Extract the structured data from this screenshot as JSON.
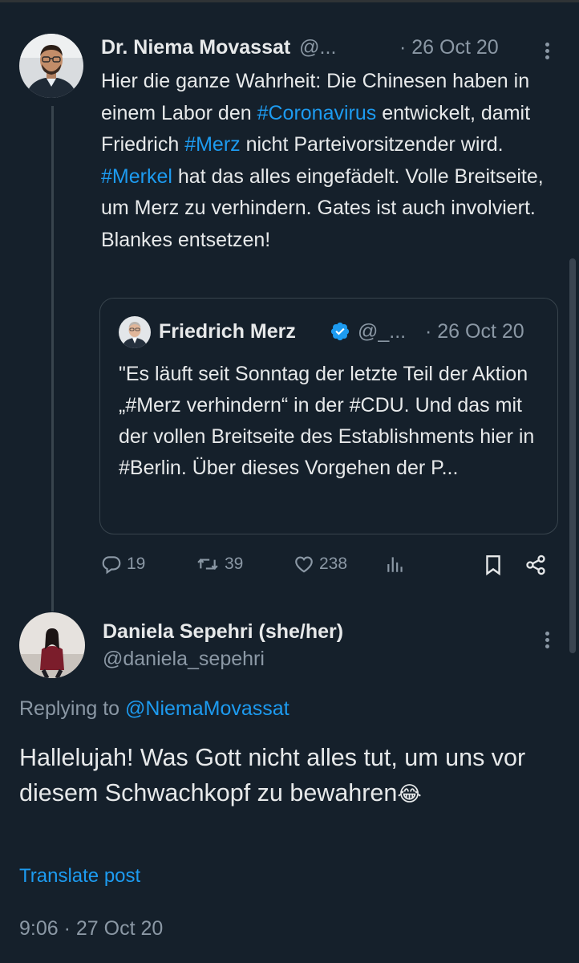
{
  "tweet": {
    "author_name": "Dr. Niema Movassat",
    "author_handle": "@...",
    "date": "· 26 Oct 20",
    "text_parts": [
      {
        "t": "Hier die ganze Wahrheit: Die Chinesen haben in einem Labor den "
      },
      {
        "t": "#Coronavirus",
        "link": true
      },
      {
        "t": " entwickelt, damit Friedrich "
      },
      {
        "t": "#Merz",
        "link": true
      },
      {
        "t": " nicht Parteivorsitzender wird. "
      },
      {
        "t": "#Merkel",
        "link": true
      },
      {
        "t": " hat das alles eingefädelt. Volle Breitseite, um Merz zu verhindern. Gates ist auch involviert. Blankes entsetzen!"
      }
    ]
  },
  "quote": {
    "author_name": "Friedrich Merz",
    "author_handle": "@_...",
    "date": "· 26 Oct 20",
    "text": "\"Es läuft seit Sonntag der letzte Teil der Aktion „#Merz verhindern“ in der #CDU. Und das mit der vollen Breitseite des Establishments hier in #Berlin. Über dieses Vorgehen der P..."
  },
  "actions": {
    "replies": "19",
    "reposts": "39",
    "likes": "238"
  },
  "reply": {
    "author_name": "Daniela Sepehri (she/her)",
    "author_handle": "@daniela_sepehri",
    "replying_prefix": "Replying to",
    "replying_handle": "@NiemaMovassat",
    "text": "Hallelujah! Was Gott nicht alles tut, um uns vor diesem Schwachkopf zu bewahren",
    "emoji": "😂",
    "translate": "Translate post",
    "timestamp": "9:06 · 27 Oct 20"
  },
  "colors": {
    "background": "#15202b",
    "link": "#1d9bf0",
    "muted": "#8b98a5",
    "verified": "#1d9bf0"
  },
  "icons": [
    "more-icon",
    "reply-icon",
    "repost-icon",
    "like-icon",
    "views-icon",
    "bookmark-icon",
    "share-icon",
    "verified-badge-icon"
  ]
}
